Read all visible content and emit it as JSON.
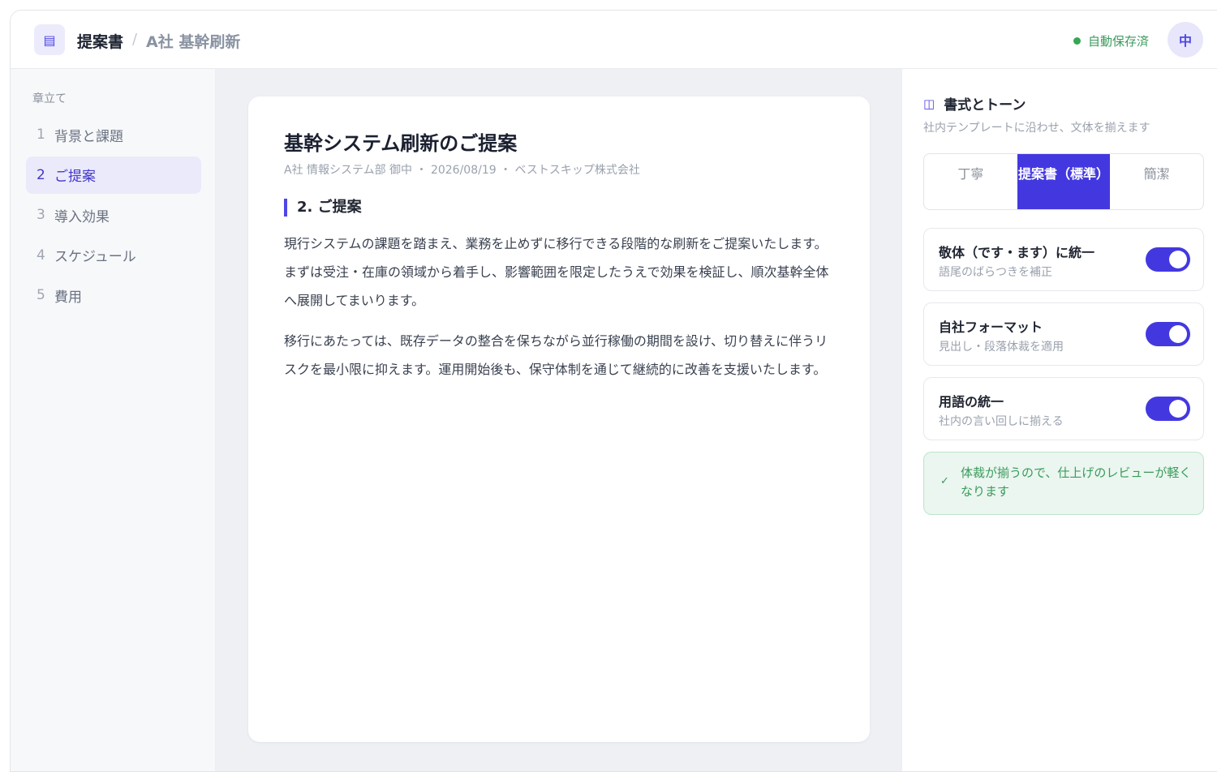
{
  "header": {
    "doc_icon": "document-icon",
    "doc_type": "提案書",
    "separator": "/",
    "doc_name": "A社 基幹刷新",
    "save_status": "自動保存済",
    "avatar": "中"
  },
  "sidebar": {
    "heading": "章立て",
    "items": [
      {
        "num": "1",
        "label": "背景と課題",
        "active": false
      },
      {
        "num": "2",
        "label": "ご提案",
        "active": true
      },
      {
        "num": "3",
        "label": "導入効果",
        "active": false
      },
      {
        "num": "4",
        "label": "スケジュール",
        "active": false
      },
      {
        "num": "5",
        "label": "費用",
        "active": false
      }
    ]
  },
  "document": {
    "title": "基幹システム刷新のご提案",
    "meta": "A社 情報システム部 御中 ・ 2026/08/19 ・ ベストスキップ株式会社",
    "section": "2. ご提案",
    "paragraphs": [
      "現行システムの課題を踏まえ、業務を止めずに移行できる段階的な刷新をご提案いたします。まずは受注・在庫の領域から着手し、影響範囲を限定したうえで効果を検証し、順次基幹全体へ展開してまいります。",
      "移行にあたっては、既存データの整合を保ちながら並行稼働の期間を設け、切り替えに伴うリスクを最小限に抑えます。運用開始後も、保守体制を通じて継続的に改善を支援いたします。"
    ]
  },
  "panel": {
    "icon": "book-open-icon",
    "title": "書式とトーン",
    "subtitle": "社内テンプレートに沿わせ、文体を揃えます",
    "tones": [
      {
        "label": "丁寧",
        "active": false
      },
      {
        "label": "提案書（標準）",
        "active": true
      },
      {
        "label": "簡潔",
        "active": false
      }
    ],
    "options": [
      {
        "title": "敬体（です・ます）に統一",
        "desc": "語尾のばらつきを補正",
        "on": true
      },
      {
        "title": "自社フォーマット",
        "desc": "見出し・段落体裁を適用",
        "on": true
      },
      {
        "title": "用語の統一",
        "desc": "社内の言い回しに揃える",
        "on": true
      }
    ],
    "note": "体裁が揃うので、仕上げのレビューが軽くなります"
  },
  "colors": {
    "accent": "#4338e0",
    "success": "#3a9a5c"
  }
}
